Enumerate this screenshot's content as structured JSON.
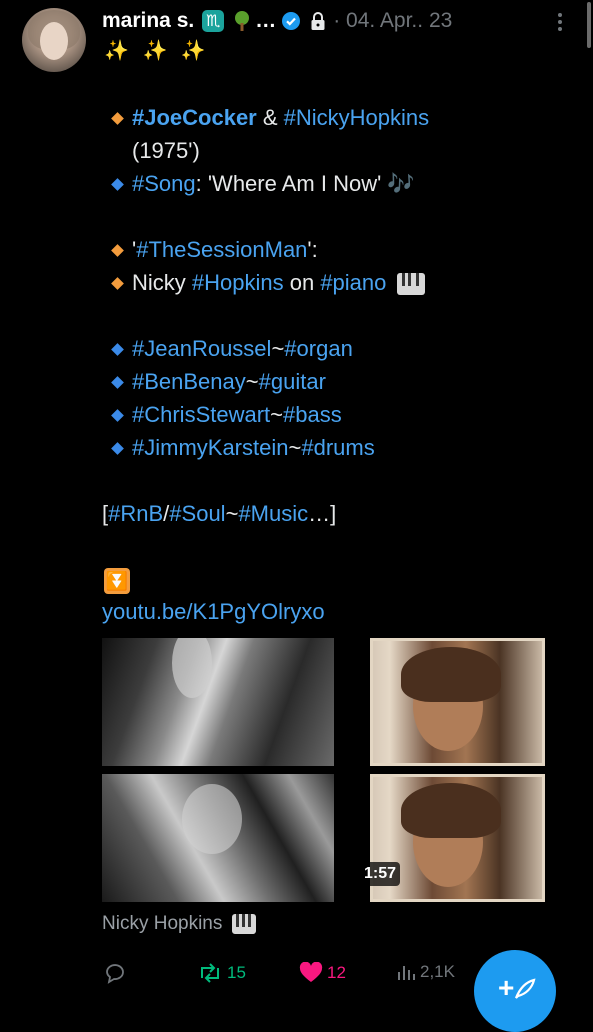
{
  "post": {
    "author_name": "marina s.",
    "name_ellipsis": "…",
    "date": "· 04. Apr.. 23",
    "sparkles": "✨ ✨ ✨",
    "lines": [
      {
        "parts": [
          {
            "text": "#JoeCocker",
            "style": "tag bold"
          },
          {
            "text": " & ",
            "style": ""
          },
          {
            "text": "#NickyHopkins",
            "style": "tag"
          }
        ],
        "bullet": "orange"
      },
      {
        "parts": [
          {
            "text": "(1975')",
            "style": ""
          }
        ],
        "bullet": ""
      },
      {
        "parts": [
          {
            "text": "#Song",
            "style": "tag"
          },
          {
            "text": ": 'Where Am I Now' ",
            "style": ""
          },
          {
            "text": "🎶",
            "style": "tag"
          }
        ],
        "bullet": "blue"
      },
      {
        "parts": [
          {
            "text": "'",
            "style": ""
          },
          {
            "text": "#TheSessionMan",
            "style": "tag"
          },
          {
            "text": "':",
            "style": ""
          }
        ],
        "bullet": "orange"
      },
      {
        "parts": [
          {
            "text": "Nicky ",
            "style": ""
          },
          {
            "text": "#Hopkins",
            "style": "tag"
          },
          {
            "text": " on ",
            "style": ""
          },
          {
            "text": "#piano",
            "style": "tag"
          }
        ],
        "bullet": "orange",
        "piano": true
      },
      {
        "parts": [
          {
            "text": "#JeanRoussel",
            "style": "tag"
          },
          {
            "text": "~",
            "style": ""
          },
          {
            "text": "#organ",
            "style": "tag"
          }
        ],
        "bullet": "blue"
      },
      {
        "parts": [
          {
            "text": "#BenBenay",
            "style": "tag"
          },
          {
            "text": "~",
            "style": ""
          },
          {
            "text": "#guitar",
            "style": "tag"
          }
        ],
        "bullet": "blue"
      },
      {
        "parts": [
          {
            "text": "#ChrisStewart",
            "style": "tag"
          },
          {
            "text": "~",
            "style": ""
          },
          {
            "text": "#bass",
            "style": "tag"
          }
        ],
        "bullet": "blue"
      },
      {
        "parts": [
          {
            "text": "#JimmyKarstein",
            "style": "tag"
          },
          {
            "text": "~",
            "style": ""
          },
          {
            "text": "#drums",
            "style": "tag"
          }
        ],
        "bullet": "blue"
      },
      {
        "parts": [
          {
            "text": "[",
            "style": ""
          },
          {
            "text": "#RnB",
            "style": "tag"
          },
          {
            "text": "/",
            "style": ""
          },
          {
            "text": "#Soul",
            "style": "tag"
          },
          {
            "text": "~",
            "style": ""
          },
          {
            "text": "#Music",
            "style": "tag"
          },
          {
            "text": "…]",
            "style": ""
          }
        ],
        "bullet": "none"
      }
    ],
    "link": "youtu.be/K1PgYOlryxo",
    "video_duration": "1:57",
    "caption": "Nicky Hopkins",
    "retweets": "15",
    "likes": "12",
    "views": "2,1K"
  },
  "colors": {
    "accent": "#1d9bf0",
    "hashtag": "#4aa3f0",
    "like": "#f91880",
    "retweet": "#00ba7c",
    "muted": "#71767b"
  }
}
